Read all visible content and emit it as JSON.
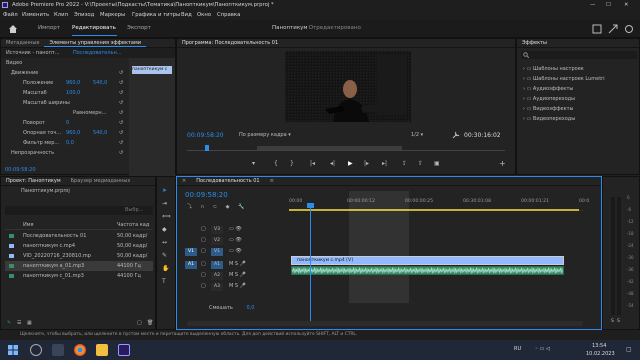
{
  "app": {
    "title": "Adobe Premiere Pro 2022 - V:\\Проекты\\Подкасты\\Тематика\\Панопткикум\\Панопткикум.prproj *"
  },
  "menu": [
    "Файл",
    "Изменить",
    "Клип",
    "Эпизод",
    "Маркеры",
    "Графика и титры",
    "Вид",
    "Окно",
    "Справка"
  ],
  "workspace": {
    "tabs": [
      "Импорт",
      "Редактировать",
      "Экспорт"
    ],
    "center_title": "Паноптикум",
    "center_status": "- Отредактировано"
  },
  "effect_controls": {
    "tabs": [
      "Метаданные",
      "Элементы управления эффектами"
    ],
    "source_label": "Источник - панопт...",
    "clip_label": "Последовательн...",
    "mini_clip": "панопткикум c",
    "video_header": "Видео",
    "rows": [
      {
        "name": "Движение",
        "v1": "",
        "v2": ""
      },
      {
        "name": "Положение",
        "v1": "960,0",
        "v2": "540,0"
      },
      {
        "name": "Масштаб",
        "v1": "100,0",
        "v2": ""
      },
      {
        "name": "Масштаб ширины",
        "v1": "",
        "v2": ""
      },
      {
        "name": "",
        "v1": "",
        "v2": "Равномерн..."
      },
      {
        "name": "Поворот",
        "v1": "0",
        "v2": ""
      },
      {
        "name": "Опорная точ...",
        "v1": "960,0",
        "v2": "540,0"
      },
      {
        "name": "Фильтр мер...",
        "v1": "0,0",
        "v2": ""
      },
      {
        "name": "Непрозрачность",
        "v1": "",
        "v2": ""
      }
    ],
    "timecode": "00:09:58:20"
  },
  "program": {
    "title": "Программа: Последовательность 01",
    "timecode": "00:09:58:20",
    "fit": "По размеру кадра",
    "fraction": "1/2",
    "duration": "00:30:16:02"
  },
  "effects": {
    "title": "Эффекты",
    "items": [
      "Шаблоны настроек",
      "Шаблоны настроек Lumetri",
      "Аудиоэффекты",
      "Аудиопереходы",
      "Видеоэффекты",
      "Видеопереходы"
    ]
  },
  "project": {
    "tabs": [
      "Проект: Паноптикум",
      "Браузер медиаданных"
    ],
    "file": "Паноптикум.prproj",
    "search_placeholder": "Выбр...",
    "col_name": "Имя",
    "col_rate": "Частота кад",
    "items": [
      {
        "name": "Последовательность 01",
        "rate": "50,00 кадр/"
      },
      {
        "name": "панопткикум c.mp4",
        "rate": "50,00 кадр/"
      },
      {
        "name": "VID_20220716_230810.mp",
        "rate": "50,00 кадр/"
      },
      {
        "name": "панопткикум a_01.mp3",
        "rate": "44100 Гц"
      },
      {
        "name": "панопткикум c_01.mp3",
        "rate": "44100 Гц"
      }
    ]
  },
  "timeline": {
    "tab": "Последовательность 01",
    "timecode": "00:09:58:20",
    "ruler": [
      "00:00",
      "00:00:00:12",
      "00:00:00:25",
      "00:30:01:08",
      "00:00:01:21",
      "00:0"
    ],
    "video_tracks": [
      "V3",
      "V2",
      "V1"
    ],
    "audio_tracks": [
      "A1",
      "A2",
      "A3"
    ],
    "src_v": "V1",
    "src_a": "A1",
    "clip": "панопткикум c.mp4 [V]",
    "mix": "Смешать",
    "mix_val": "0,0"
  },
  "status": "Щелкните, чтобы выбрать, или щелкните в пустом месте и перетащите выделенную область. Для доп действий используйте SHIFT, ALT и CTRL.",
  "taskbar": {
    "lang": "RU",
    "time": "13:54",
    "date": "10.02.2023"
  },
  "colors": {
    "accent": "#2d8ceb",
    "audio": "#3a8c6a",
    "video": "#92b8ff"
  }
}
